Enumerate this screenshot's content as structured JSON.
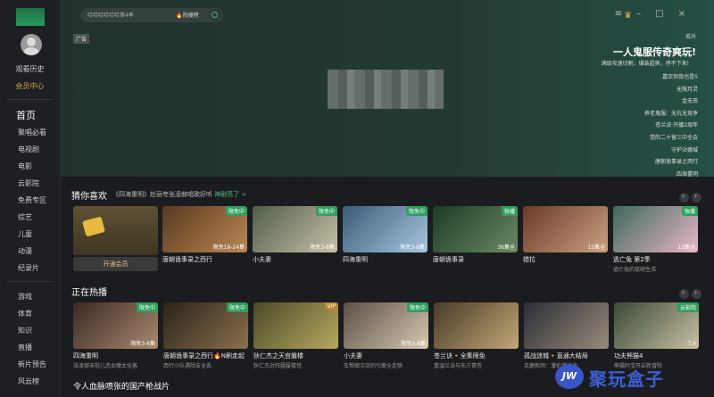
{
  "sidebar": {
    "history": "观看历史",
    "vip_center": "会员中心",
    "nav": [
      "首页",
      "聚唱必看",
      "电视剧",
      "电影",
      "云影院",
      "免费专区",
      "综艺",
      "儿童",
      "动漫",
      "纪录片"
    ],
    "nav2": [
      "游戏",
      "体育",
      "知识",
      "直播",
      "新片预告",
      "风云榜"
    ]
  },
  "search": {
    "placeholder": "哈哈哈哈哈哈第4季",
    "hot": "热搜榜"
  },
  "hero": {
    "ad_tag": "广告",
    "close": "孤舟",
    "title": "一人鬼服传奇爽玩!",
    "subtitle": "满级攻速切割，爆装超爽，停不下来!",
    "list": [
      "嘉欢你我也是5",
      "无限月灵",
      "金无双",
      "养老鬼服：无坑无竞争",
      "苍兰诀·开播2周年",
      "觉的二十留三中全会",
      "守护沾德城",
      "唐朝诡事录之西行",
      "四海重明"
    ]
  },
  "row1": {
    "title": "猜你喜欢",
    "tail": "《四海重明》赵丽夸张凌赫唱歌好听",
    "more": "神剧亮了 >",
    "vip_button": "开通会员",
    "cards": [
      {
        "title": "唐朝诡事录之西行",
        "sub": "",
        "tag": "限免中",
        "ep": "限免18-24集",
        "c1": "#5a3a22",
        "c2": "#b98752",
        "tagc": "#2f9f60"
      },
      {
        "title": "小夫妻",
        "sub": "",
        "tag": "限免中",
        "ep": "限免3-8集",
        "c1": "#4f5d4a",
        "c2": "#c9c1a8",
        "tagc": "#2f9f60"
      },
      {
        "title": "四海重明",
        "sub": "",
        "tag": "限免中",
        "ep": "限免3-6集",
        "c1": "#3a5b7a",
        "c2": "#a8c6dc",
        "tagc": "#2f9f60"
      },
      {
        "title": "唐朝诡事录",
        "sub": "",
        "tag": "独播",
        "ep": "36集全",
        "c1": "#1e3a2a",
        "c2": "#6a8a60",
        "tagc": "#2f9f60"
      },
      {
        "title": "猎拉",
        "sub": "",
        "tag": "",
        "ep": "15集全",
        "c1": "#6b3a2a",
        "c2": "#caa180",
        "tagc": "#2f9f60"
      },
      {
        "title": "逃亡兔 第2季",
        "sub": "逃亡兔的鼠绑生活",
        "tag": "独播",
        "ep": "13集全",
        "c1": "#3d6a58",
        "c2": "#e8b6c8",
        "tagc": "#2f9f60"
      }
    ]
  },
  "row2": {
    "title": "正在热播",
    "cards": [
      {
        "title": "四海重明",
        "sub": "张凌赫宋祖儿恋女魔太化客",
        "tag": "限免中",
        "ep": "限免3-6集",
        "c1": "#3b2a22",
        "c2": "#a88a70",
        "tagc": "#2f9f60"
      },
      {
        "title": "唐朝诡事录之西行🔥N刷走起",
        "sub": "西行小队遇险友全丢",
        "tag": "限免中",
        "ep": "",
        "c1": "#2b2418",
        "c2": "#8a7050",
        "tagc": "#2f9f60"
      },
      {
        "title": "狄仁杰之天宫蜃楼",
        "sub": "狄仁杰对阵疆蜃楼怪",
        "tag": "VIP",
        "ep": "",
        "c1": "#4a4a2a",
        "c2": "#b8a860",
        "tagc": "#b8862f"
      },
      {
        "title": "小夫妻",
        "sub": "车帮娜次突的引面全走够",
        "tag": "限免中",
        "ep": "限免3-8集",
        "c1": "#5a5046",
        "c2": "#d8c8b0",
        "tagc": "#2f9f60"
      },
      {
        "title": "苍兰诀🔸全集限免",
        "sub": "重温兰诀与东方青苍",
        "tag": "",
        "ep": "",
        "c1": "#4a3a28",
        "c2": "#c0a878",
        "tagc": "#2f9f60"
      },
      {
        "title": "孤战迷城🔸直通大结局",
        "sub": "克鹿新网：潘伦谋浅浪",
        "tag": "",
        "ep": "",
        "c1": "#2a2e36",
        "c2": "#9a8a7a",
        "tagc": "#2f9f60"
      },
      {
        "title": "功夫熊猫4",
        "sub": "熊猫阿宝开启新冒险",
        "tag": "云影院",
        "ep": "7.6",
        "c1": "#3a4a3a",
        "c2": "#c8c0a0",
        "tagc": "#2f9f60"
      }
    ]
  },
  "row3": {
    "title": "令人血脉喷张的国产枪战片"
  },
  "watermark": {
    "badge": "JW",
    "text": "聚玩盒子"
  }
}
